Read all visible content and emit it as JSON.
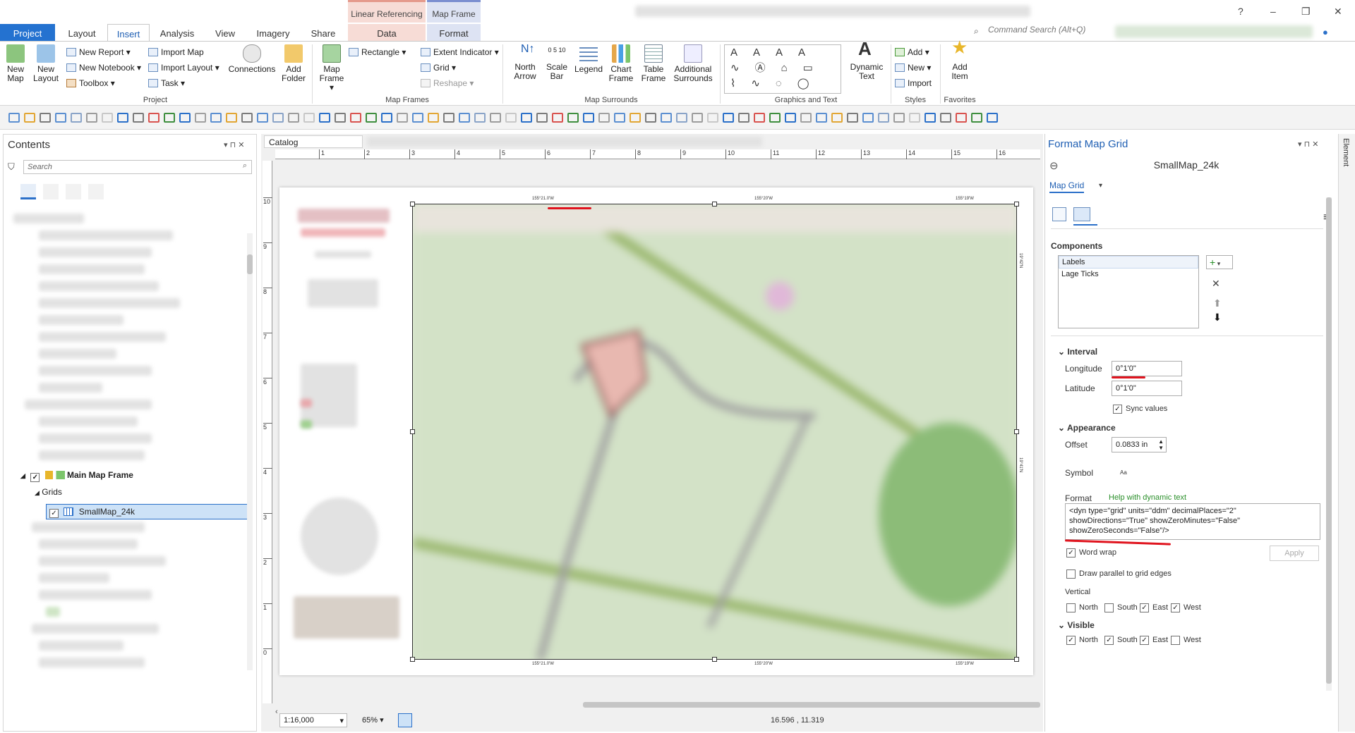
{
  "window": {
    "help": "?",
    "minimize": "–",
    "maximize": "❐",
    "close": "✕"
  },
  "tabs": {
    "project": "Project",
    "layout": "Layout",
    "insert": "Insert",
    "analysis": "Analysis",
    "view": "View",
    "imagery": "Imagery",
    "share": "Share",
    "data": "Data",
    "format": "Format"
  },
  "contextual": {
    "linear_ref": "Linear Referencing",
    "map_frame": "Map Frame"
  },
  "command_search": {
    "placeholder": "Command Search (Alt+Q)"
  },
  "ribbon": {
    "new_map": "New Map",
    "new_layout": "New Layout",
    "new_report": "New Report",
    "new_notebook": "New Notebook",
    "toolbox": "Toolbox",
    "import_map": "Import Map",
    "import_layout": "Import Layout",
    "task": "Task",
    "connections": "Connections",
    "add_folder": "Add Folder",
    "group_project": "Project",
    "map_frame": "Map Frame",
    "rectangle": "Rectangle",
    "extent_indicator": "Extent Indicator",
    "grid": "Grid",
    "reshape": "Reshape",
    "group_map_frames": "Map Frames",
    "north_arrow": "North Arrow",
    "scale_bar": "Scale Bar",
    "legend": "Legend",
    "chart_frame": "Chart Frame",
    "table_frame": "Table Frame",
    "additional_surrounds": "Additional Surrounds",
    "group_map_surrounds": "Map Surrounds",
    "group_graphics_text": "Graphics and Text",
    "dynamic_text": "Dynamic Text",
    "add": "Add",
    "new": "New",
    "import": "Import",
    "group_styles": "Styles",
    "add_item": "Add Item",
    "group_favorites": "Favorites",
    "scale_ticks": "0  5 10"
  },
  "contents": {
    "title": "Contents",
    "search_placeholder": "Search",
    "main_map_frame": "Main Map Frame",
    "grids": "Grids",
    "smallmap": "SmallMap_24k"
  },
  "mapview": {
    "tab_catalog": "Catalog",
    "scale": "1:16,000",
    "zoom": "65%",
    "coords": "16.596 , 11.319",
    "ruler_top": [
      "1",
      "2",
      "3",
      "4",
      "5",
      "6",
      "7",
      "8",
      "9",
      "10",
      "11",
      "12",
      "13",
      "14",
      "15",
      "16"
    ],
    "ruler_left": [
      "10",
      "9",
      "8",
      "7",
      "6",
      "5",
      "4",
      "3",
      "2",
      "1",
      "0"
    ],
    "grid_labels_top": [
      "155°21.0'W",
      "155°20'W",
      "155°19'W"
    ],
    "grid_labels_bottom": [
      "155°21.0'W",
      "155°20'W",
      "155°19'W"
    ],
    "grid_labels_right": [
      "19°42'N",
      "19°41'N"
    ]
  },
  "format_pane": {
    "title": "Format Map Grid",
    "subject": "SmallMap_24k",
    "dropdown": "Map Grid",
    "components_hdr": "Components",
    "components": [
      "Labels",
      "Lage Ticks"
    ],
    "interval_hdr": "Interval",
    "longitude_label": "Longitude",
    "longitude_value": "0°1'0\"",
    "latitude_label": "Latitude",
    "latitude_value": "0°1'0\"",
    "sync_values": "Sync values",
    "appearance_hdr": "Appearance",
    "offset_label": "Offset",
    "offset_value": "0.0833 in",
    "symbol_label": "Symbol",
    "symbol_glyph": "Aa",
    "format_label": "Format",
    "help_link": "Help with dynamic text",
    "format_text": "<dyn type=\"grid\" units=\"ddm\" decimalPlaces=\"2\" showDirections=\"True\" showZeroMinutes=\"False\" showZeroSeconds=\"False\"/>",
    "word_wrap": "Word wrap",
    "apply": "Apply",
    "draw_parallel": "Draw parallel to grid edges",
    "vertical_hdr": "Vertical",
    "visible_hdr": "Visible",
    "north": "North",
    "south": "South",
    "east": "East",
    "west": "West"
  },
  "element_strip": "Element"
}
